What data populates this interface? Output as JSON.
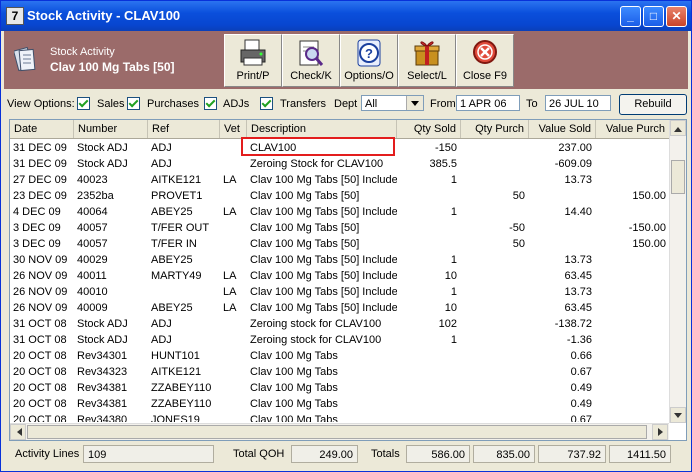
{
  "window": {
    "title": "Stock Activity - CLAV100",
    "icon": "7"
  },
  "header": {
    "label": "Stock Activity",
    "product": "Clav 100 Mg Tabs [50]"
  },
  "toolbar": {
    "print": "Print/P",
    "check": "Check/K",
    "options": "Options/O",
    "select": "Select/L",
    "close": "Close F9"
  },
  "view_options": {
    "label": "View Options:",
    "sales": "Sales",
    "purchases": "Purchases",
    "adjs": "ADJs",
    "transfers": "Transfers",
    "dept_label": "Dept",
    "dept_value": "All",
    "from_label": "From",
    "from_value": "1 APR 06",
    "to_label": "To",
    "to_value": "26 JUL 10",
    "rebuild": "Rebuild"
  },
  "columns": [
    "Date",
    "Number",
    "Ref",
    "Vet",
    "Description",
    "Qty Sold",
    "Qty Purch",
    "Value Sold",
    "Value Purch"
  ],
  "rows": [
    [
      "31 DEC 09",
      "Stock ADJ",
      "ADJ",
      "",
      "CLAV100",
      "-150",
      "",
      "237.00",
      ""
    ],
    [
      "31 DEC 09",
      "Stock ADJ",
      "ADJ",
      "",
      "Zeroing Stock for CLAV100",
      "385.5",
      "",
      "-609.09",
      ""
    ],
    [
      "27 DEC 09",
      "40023",
      "AITKE121",
      "LA",
      "Clav 100 Mg Tabs [50] Include",
      "1",
      "",
      "13.73",
      ""
    ],
    [
      "23 DEC 09",
      "2352ba",
      "PROVET1",
      "",
      "Clav 100 Mg Tabs [50]",
      "",
      "50",
      "",
      "150.00"
    ],
    [
      "4 DEC 09",
      "40064",
      "ABEY25",
      "LA",
      "Clav 100 Mg Tabs [50] Include",
      "1",
      "",
      "14.40",
      ""
    ],
    [
      "3 DEC 09",
      "40057",
      "T/FER OUT",
      "",
      "Clav 100 Mg Tabs [50]",
      "",
      "-50",
      "",
      "-150.00"
    ],
    [
      "3 DEC 09",
      "40057",
      "T/FER IN",
      "",
      "Clav 100 Mg Tabs [50]",
      "",
      "50",
      "",
      "150.00"
    ],
    [
      "30 NOV 09",
      "40029",
      "ABEY25",
      "",
      "Clav 100 Mg Tabs [50] Include",
      "1",
      "",
      "13.73",
      ""
    ],
    [
      "26 NOV 09",
      "40011",
      "MARTY49",
      "LA",
      "Clav 100 Mg Tabs [50] Include",
      "10",
      "",
      "63.45",
      ""
    ],
    [
      "26 NOV 09",
      "40010",
      "",
      "LA",
      "Clav 100 Mg Tabs [50] Include",
      "1",
      "",
      "13.73",
      ""
    ],
    [
      "26 NOV 09",
      "40009",
      "ABEY25",
      "LA",
      "Clav 100 Mg Tabs [50] Include",
      "10",
      "",
      "63.45",
      ""
    ],
    [
      "31 OCT 08",
      "Stock ADJ",
      "ADJ",
      "",
      "Zeroing stock for CLAV100",
      "102",
      "",
      "-138.72",
      ""
    ],
    [
      "31 OCT 08",
      "Stock ADJ",
      "ADJ",
      "",
      "Zeroing stock for CLAV100",
      "1",
      "",
      "-1.36",
      ""
    ],
    [
      "20 OCT 08",
      "Rev34301",
      "HUNT101",
      "",
      "Clav 100 Mg Tabs",
      "",
      "",
      "0.66",
      ""
    ],
    [
      "20 OCT 08",
      "Rev34323",
      "AITKE121",
      "",
      "Clav 100 Mg Tabs",
      "",
      "",
      "0.67",
      ""
    ],
    [
      "20 OCT 08",
      "Rev34381",
      "ZZABEY110",
      "",
      "Clav 100 Mg Tabs",
      "",
      "",
      "0.49",
      ""
    ],
    [
      "20 OCT 08",
      "Rev34381",
      "ZZABEY110",
      "",
      "Clav 100 Mg Tabs",
      "",
      "",
      "0.49",
      ""
    ],
    [
      "20 OCT 08",
      "Rev34380",
      "JONES19",
      "",
      "Clav 100 Mg Tabs",
      "",
      "",
      "0.67",
      ""
    ]
  ],
  "status": {
    "activity_label": "Activity Lines",
    "activity_value": "109",
    "qoh_label": "Total QOH",
    "qoh_value": "249.00",
    "totals_label": "Totals",
    "t_qty_sold": "586.00",
    "t_qty_purch": "835.00",
    "t_value_sold": "737.92",
    "t_value_purch": "1411.50"
  },
  "colors": {
    "title_bar": "#0a4fdc",
    "header_panel": "#9b6b6a",
    "highlight": "#e31d1d",
    "check": "#21a121"
  }
}
